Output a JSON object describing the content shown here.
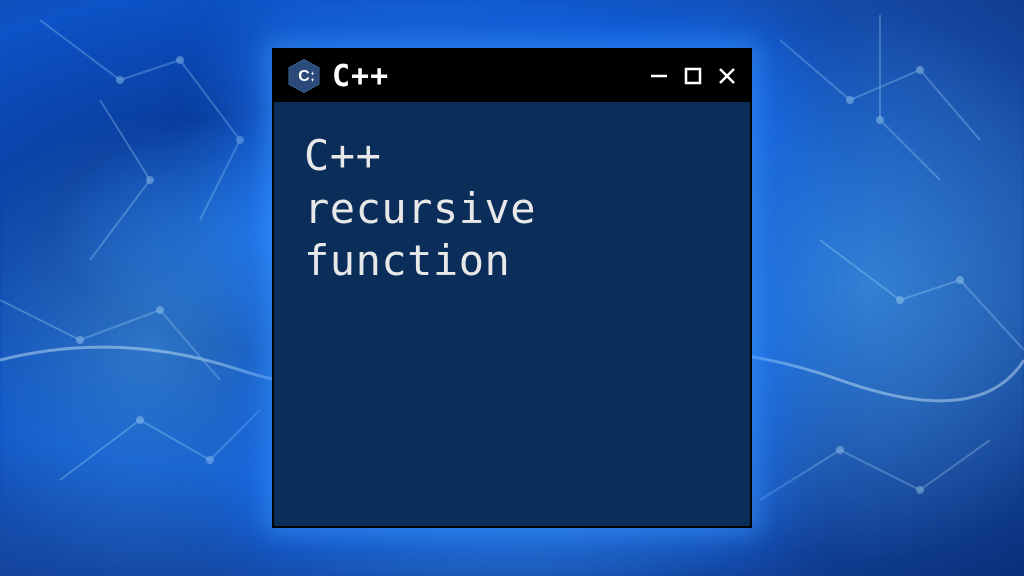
{
  "background": {
    "theme_colors": [
      "#1a6bdf",
      "#0a3d9e",
      "#0d52c7",
      "#0a2f7a"
    ],
    "glow_color": "rgba(30,120,255,0.6)"
  },
  "window": {
    "title": "C++",
    "icon": "cpp-hexagon-icon",
    "body_lines": [
      "C++",
      "recursive",
      "function"
    ],
    "controls": {
      "minimize": "−",
      "maximize": "□",
      "close": "×"
    }
  }
}
